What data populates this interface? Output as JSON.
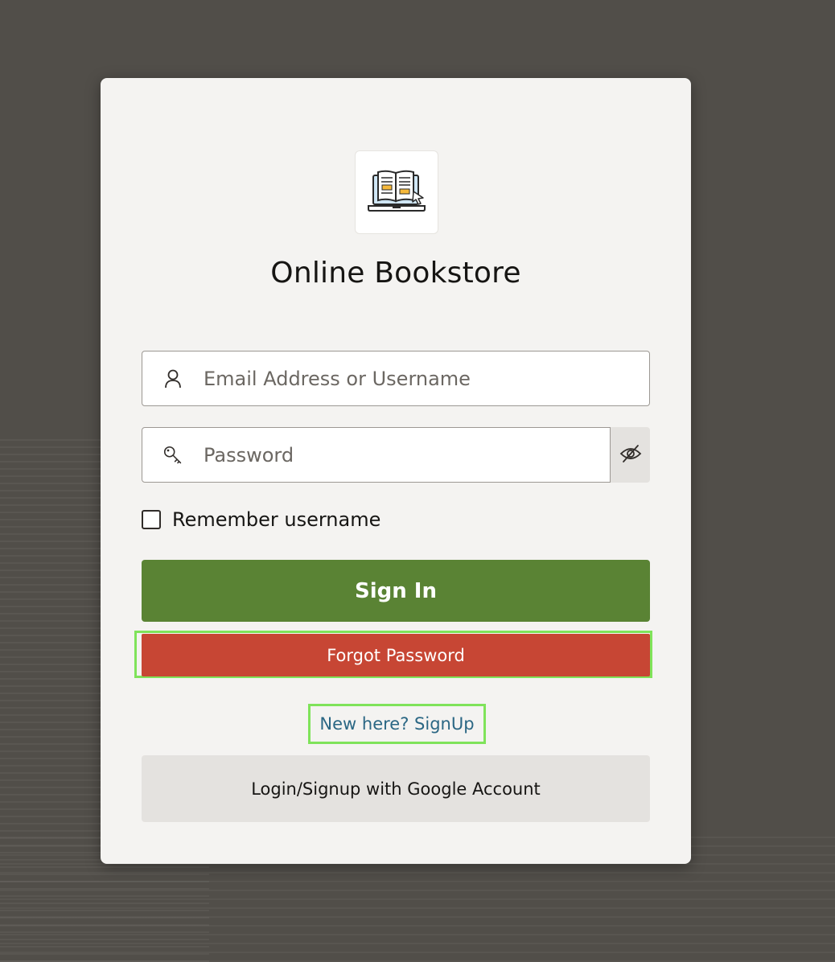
{
  "app": {
    "title": "Online Bookstore",
    "logo_icon": "laptop-book-icon"
  },
  "login_form": {
    "username_placeholder": "Email Address or Username",
    "username_value": "",
    "username_icon": "user-icon",
    "password_placeholder": "Password",
    "password_value": "",
    "password_icon": "key-icon",
    "toggle_visibility_icon": "eye-slash-icon",
    "remember_label": "Remember username",
    "remember_checked": false
  },
  "actions": {
    "sign_in_label": "Sign In",
    "forgot_password_label": "Forgot Password",
    "signup_link_label": "New here? SignUp",
    "google_label": "Login/Signup with Google Account"
  },
  "colors": {
    "background": "#514e49",
    "card": "#f4f3f1",
    "sign_in_button": "#5a8334",
    "forgot_password_button": "#c74634",
    "link": "#2b6784",
    "highlight_outline": "#7fe35a",
    "google_button": "#e4e2df"
  }
}
